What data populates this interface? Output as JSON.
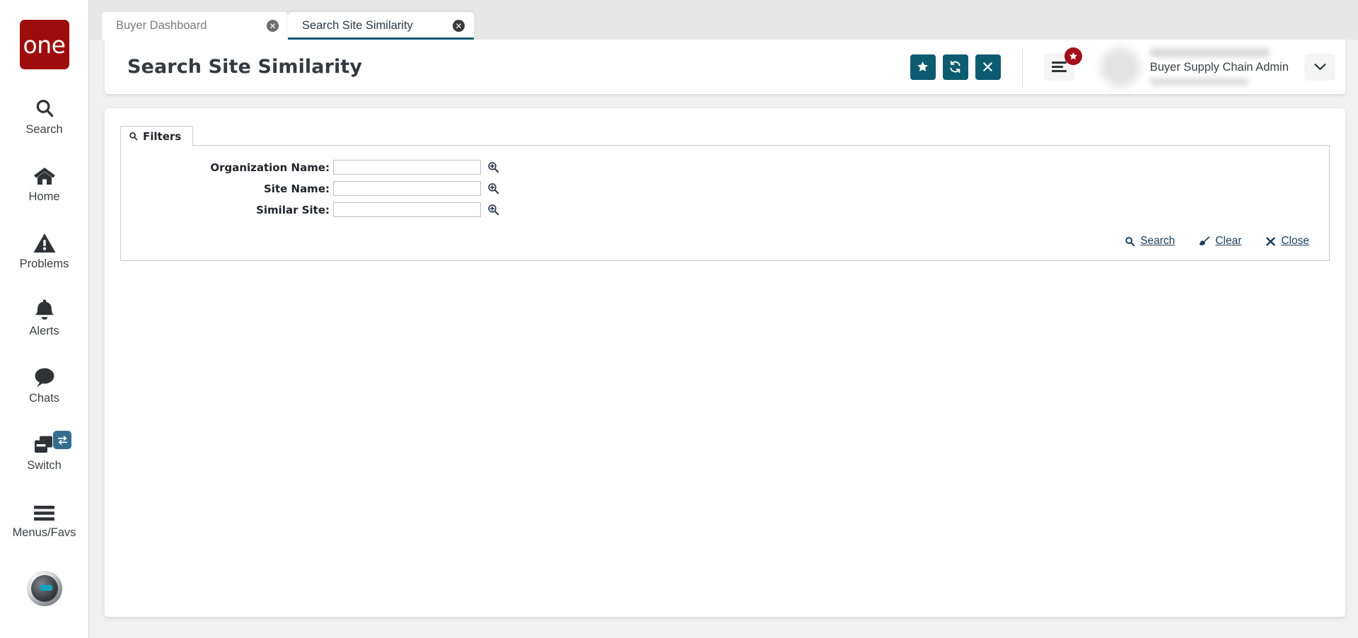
{
  "brand": {
    "logo_text": "one",
    "logo_color": "#9d0d0d",
    "accent_color": "#0d5b70"
  },
  "rail": {
    "items": [
      {
        "label": "Search",
        "icon": "search-icon"
      },
      {
        "label": "Home",
        "icon": "home-icon"
      },
      {
        "label": "Problems",
        "icon": "warning-triangle-icon"
      },
      {
        "label": "Alerts",
        "icon": "bell-icon"
      },
      {
        "label": "Chats",
        "icon": "chat-bubble-icon"
      },
      {
        "label": "Switch",
        "icon": "windows-stack-icon"
      },
      {
        "label": "Menus/Favs",
        "icon": "hamburger-icon"
      }
    ],
    "avatar_icon": "user-avatar-icon"
  },
  "tabs": [
    {
      "label": "Buyer Dashboard",
      "active": false
    },
    {
      "label": "Search Site Similarity",
      "active": true
    }
  ],
  "header": {
    "title": "Search Site Similarity",
    "buttons": [
      {
        "name": "favorite-button",
        "icon": "star-icon"
      },
      {
        "name": "refresh-button",
        "icon": "refresh-icon"
      },
      {
        "name": "close-button",
        "icon": "close-x-icon"
      }
    ],
    "menu_badge_icon": "star-icon",
    "user_role": "Buyer Supply Chain Admin",
    "caret": "⌄"
  },
  "filters": {
    "panel_label": "Filters",
    "fields": [
      {
        "label": "Organization Name:",
        "value": "",
        "placeholder": ""
      },
      {
        "label": "Site Name:",
        "value": "",
        "placeholder": ""
      },
      {
        "label": "Similar Site:",
        "value": "",
        "placeholder": ""
      }
    ],
    "actions": [
      {
        "label": "Search",
        "icon": "search-icon"
      },
      {
        "label": "Clear",
        "icon": "broom-icon"
      },
      {
        "label": "Close",
        "icon": "close-x-icon"
      }
    ]
  }
}
